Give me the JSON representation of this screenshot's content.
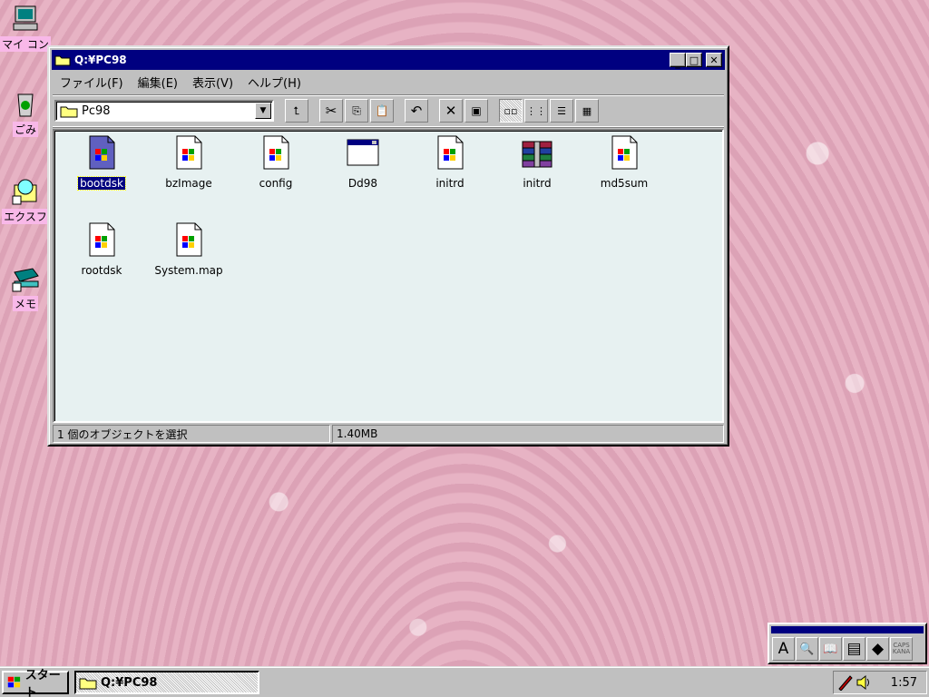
{
  "desktop": {
    "icons": [
      {
        "label": "マイ コン",
        "icon": "my-computer-icon"
      },
      {
        "label": "ごみ",
        "icon": "recycle-bin-icon"
      },
      {
        "label": "エクスフ",
        "icon": "explorer-icon"
      },
      {
        "label": "メモ",
        "icon": "notepad-icon"
      }
    ]
  },
  "window": {
    "title": "Q:¥PC98",
    "menu": [
      "ファイル(F)",
      "編集(E)",
      "表示(V)",
      "ヘルプ(H)"
    ],
    "address": "Pc98",
    "files": [
      {
        "name": "bootdsk",
        "icon": "document-icon",
        "selected": true
      },
      {
        "name": "bzImage",
        "icon": "document-icon",
        "selected": false
      },
      {
        "name": "config",
        "icon": "document-icon",
        "selected": false
      },
      {
        "name": "Dd98",
        "icon": "application-window-icon",
        "selected": false
      },
      {
        "name": "initrd",
        "icon": "document-icon",
        "selected": false
      },
      {
        "name": "initrd",
        "icon": "archive-books-icon",
        "selected": false
      },
      {
        "name": "md5sum",
        "icon": "document-icon",
        "selected": false
      },
      {
        "name": "rootdsk",
        "icon": "document-icon",
        "selected": false
      },
      {
        "name": "System.map",
        "icon": "document-icon",
        "selected": false
      }
    ],
    "status": {
      "selection": "1 個のオブジェクトを選択",
      "size": "1.40MB"
    }
  },
  "ime": {
    "buttons": [
      "A",
      "🔍",
      "📖",
      "▤",
      "◆",
      "CAPS KANA"
    ]
  },
  "taskbar": {
    "start_label": "スタート",
    "task_label": "Q:¥PC98",
    "clock": "1:57"
  },
  "colors": {
    "titlebar": "#000080",
    "content_bg": "#e7f1f1",
    "desktop": "#e2aabd",
    "face": "#c0c0c0"
  }
}
